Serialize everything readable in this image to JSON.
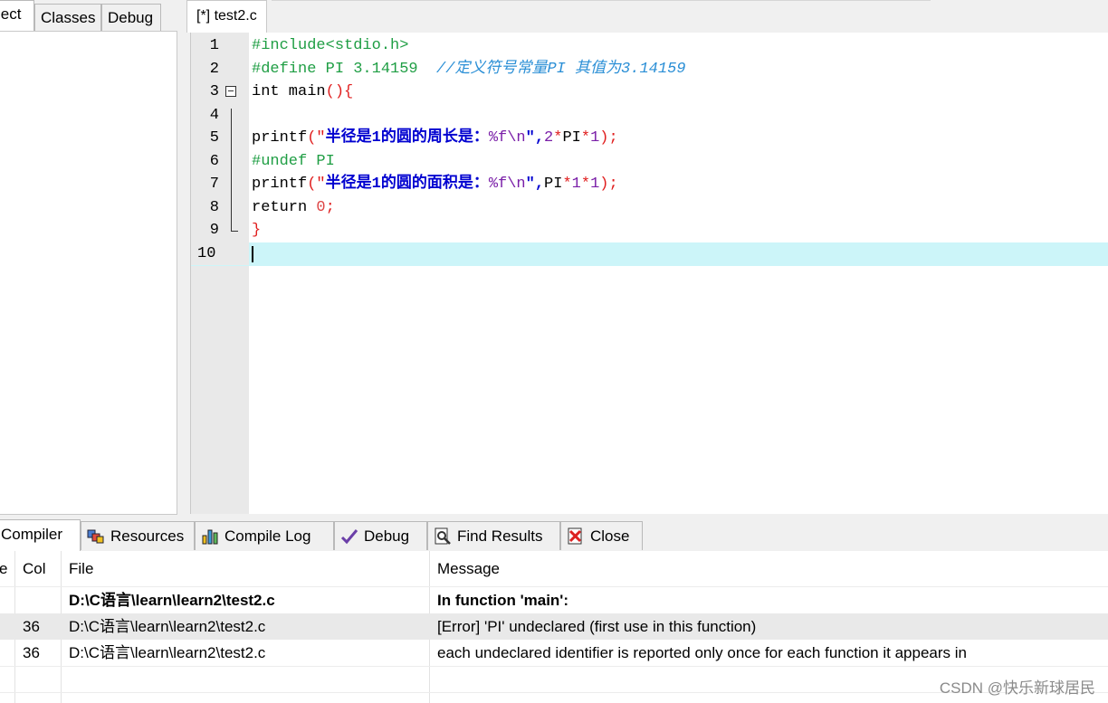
{
  "left_panel": {
    "tabs": [
      "ject",
      "Classes",
      "Debug"
    ]
  },
  "editor": {
    "tab_title": "[*] test2.c",
    "lines": [
      {
        "n": "1"
      },
      {
        "n": "2"
      },
      {
        "n": "3"
      },
      {
        "n": "4"
      },
      {
        "n": "5"
      },
      {
        "n": "6"
      },
      {
        "n": "7"
      },
      {
        "n": "8"
      },
      {
        "n": "9"
      },
      {
        "n": "10"
      }
    ],
    "code": {
      "l1": "#include<stdio.h>",
      "l2_pp": "#define PI 3.14159",
      "l2_comment": "//定义符号常量PI 其值为3.14159",
      "l3_kw": "int main",
      "l3_br": "(){",
      "l5_fn": "printf",
      "l5_open": "(\"",
      "l5_str": "半径是1的圆的周长是：",
      "l5_fmt": "%f\\n",
      "l5_close_q": "\",",
      "l5_args_a": "2",
      "l5_args_b": "*",
      "l5_args_c": "PI",
      "l5_args_d": "*",
      "l5_args_e": "1",
      "l5_end": ");",
      "l6": "#undef PI",
      "l7_fn": "printf",
      "l7_open": "(\"",
      "l7_str": "半径是1的圆的面积是：",
      "l7_fmt": "%f\\n",
      "l7_close_q": "\",",
      "l7_args_a": "PI",
      "l7_args_b": "*",
      "l7_args_c": "1",
      "l7_args_d": "*",
      "l7_args_e": "1",
      "l7_end": ");",
      "l8_kw": "return ",
      "l8_num": "0",
      "l8_end": ";",
      "l9": "}"
    }
  },
  "bottom_tabs": [
    {
      "label": "Compiler",
      "icon": "compiler-icon"
    },
    {
      "label": "Resources",
      "icon": "resources-icon"
    },
    {
      "label": "Compile Log",
      "icon": "chart-icon"
    },
    {
      "label": "Debug",
      "icon": "check-icon"
    },
    {
      "label": "Find Results",
      "icon": "find-icon"
    },
    {
      "label": "Close",
      "icon": "close-icon"
    }
  ],
  "results": {
    "columns": {
      "line": "e",
      "col": "Col",
      "file": "File",
      "message": "Message"
    },
    "rows": [
      {
        "col": "",
        "file": "D:\\C语言\\learn\\learn2\\test2.c",
        "message": "In function 'main':"
      },
      {
        "col": "36",
        "file": "D:\\C语言\\learn\\learn2\\test2.c",
        "message": "[Error] 'PI' undeclared (first use in this function)"
      },
      {
        "col": "36",
        "file": "D:\\C语言\\learn\\learn2\\test2.c",
        "message": "each undeclared identifier is reported only once for each function it appears in"
      }
    ]
  },
  "watermark": "CSDN @快乐新球居民"
}
